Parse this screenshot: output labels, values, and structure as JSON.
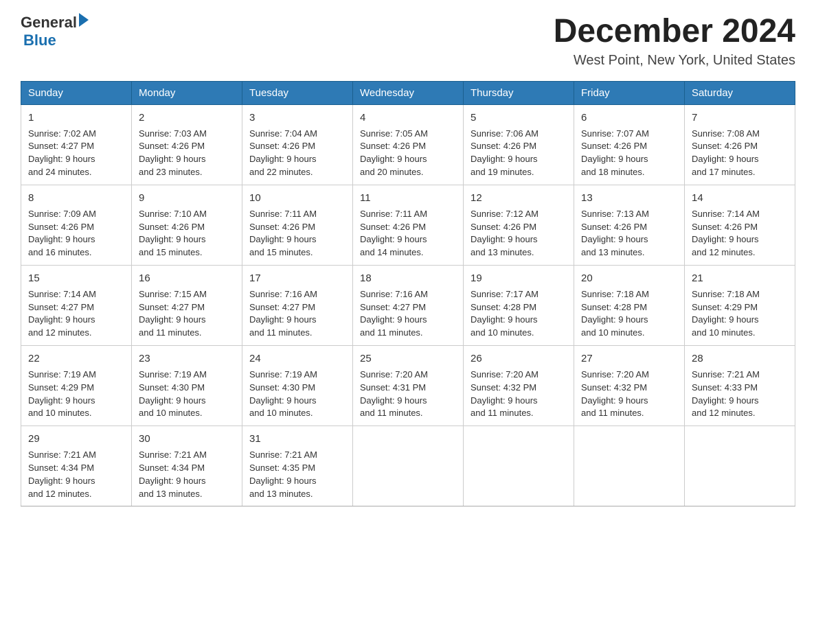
{
  "header": {
    "logo_general": "General",
    "logo_blue": "Blue",
    "month": "December 2024",
    "location": "West Point, New York, United States"
  },
  "days_of_week": [
    "Sunday",
    "Monday",
    "Tuesday",
    "Wednesday",
    "Thursday",
    "Friday",
    "Saturday"
  ],
  "weeks": [
    [
      {
        "day": 1,
        "lines": [
          "Sunrise: 7:02 AM",
          "Sunset: 4:27 PM",
          "Daylight: 9 hours",
          "and 24 minutes."
        ]
      },
      {
        "day": 2,
        "lines": [
          "Sunrise: 7:03 AM",
          "Sunset: 4:26 PM",
          "Daylight: 9 hours",
          "and 23 minutes."
        ]
      },
      {
        "day": 3,
        "lines": [
          "Sunrise: 7:04 AM",
          "Sunset: 4:26 PM",
          "Daylight: 9 hours",
          "and 22 minutes."
        ]
      },
      {
        "day": 4,
        "lines": [
          "Sunrise: 7:05 AM",
          "Sunset: 4:26 PM",
          "Daylight: 9 hours",
          "and 20 minutes."
        ]
      },
      {
        "day": 5,
        "lines": [
          "Sunrise: 7:06 AM",
          "Sunset: 4:26 PM",
          "Daylight: 9 hours",
          "and 19 minutes."
        ]
      },
      {
        "day": 6,
        "lines": [
          "Sunrise: 7:07 AM",
          "Sunset: 4:26 PM",
          "Daylight: 9 hours",
          "and 18 minutes."
        ]
      },
      {
        "day": 7,
        "lines": [
          "Sunrise: 7:08 AM",
          "Sunset: 4:26 PM",
          "Daylight: 9 hours",
          "and 17 minutes."
        ]
      }
    ],
    [
      {
        "day": 8,
        "lines": [
          "Sunrise: 7:09 AM",
          "Sunset: 4:26 PM",
          "Daylight: 9 hours",
          "and 16 minutes."
        ]
      },
      {
        "day": 9,
        "lines": [
          "Sunrise: 7:10 AM",
          "Sunset: 4:26 PM",
          "Daylight: 9 hours",
          "and 15 minutes."
        ]
      },
      {
        "day": 10,
        "lines": [
          "Sunrise: 7:11 AM",
          "Sunset: 4:26 PM",
          "Daylight: 9 hours",
          "and 15 minutes."
        ]
      },
      {
        "day": 11,
        "lines": [
          "Sunrise: 7:11 AM",
          "Sunset: 4:26 PM",
          "Daylight: 9 hours",
          "and 14 minutes."
        ]
      },
      {
        "day": 12,
        "lines": [
          "Sunrise: 7:12 AM",
          "Sunset: 4:26 PM",
          "Daylight: 9 hours",
          "and 13 minutes."
        ]
      },
      {
        "day": 13,
        "lines": [
          "Sunrise: 7:13 AM",
          "Sunset: 4:26 PM",
          "Daylight: 9 hours",
          "and 13 minutes."
        ]
      },
      {
        "day": 14,
        "lines": [
          "Sunrise: 7:14 AM",
          "Sunset: 4:26 PM",
          "Daylight: 9 hours",
          "and 12 minutes."
        ]
      }
    ],
    [
      {
        "day": 15,
        "lines": [
          "Sunrise: 7:14 AM",
          "Sunset: 4:27 PM",
          "Daylight: 9 hours",
          "and 12 minutes."
        ]
      },
      {
        "day": 16,
        "lines": [
          "Sunrise: 7:15 AM",
          "Sunset: 4:27 PM",
          "Daylight: 9 hours",
          "and 11 minutes."
        ]
      },
      {
        "day": 17,
        "lines": [
          "Sunrise: 7:16 AM",
          "Sunset: 4:27 PM",
          "Daylight: 9 hours",
          "and 11 minutes."
        ]
      },
      {
        "day": 18,
        "lines": [
          "Sunrise: 7:16 AM",
          "Sunset: 4:27 PM",
          "Daylight: 9 hours",
          "and 11 minutes."
        ]
      },
      {
        "day": 19,
        "lines": [
          "Sunrise: 7:17 AM",
          "Sunset: 4:28 PM",
          "Daylight: 9 hours",
          "and 10 minutes."
        ]
      },
      {
        "day": 20,
        "lines": [
          "Sunrise: 7:18 AM",
          "Sunset: 4:28 PM",
          "Daylight: 9 hours",
          "and 10 minutes."
        ]
      },
      {
        "day": 21,
        "lines": [
          "Sunrise: 7:18 AM",
          "Sunset: 4:29 PM",
          "Daylight: 9 hours",
          "and 10 minutes."
        ]
      }
    ],
    [
      {
        "day": 22,
        "lines": [
          "Sunrise: 7:19 AM",
          "Sunset: 4:29 PM",
          "Daylight: 9 hours",
          "and 10 minutes."
        ]
      },
      {
        "day": 23,
        "lines": [
          "Sunrise: 7:19 AM",
          "Sunset: 4:30 PM",
          "Daylight: 9 hours",
          "and 10 minutes."
        ]
      },
      {
        "day": 24,
        "lines": [
          "Sunrise: 7:19 AM",
          "Sunset: 4:30 PM",
          "Daylight: 9 hours",
          "and 10 minutes."
        ]
      },
      {
        "day": 25,
        "lines": [
          "Sunrise: 7:20 AM",
          "Sunset: 4:31 PM",
          "Daylight: 9 hours",
          "and 11 minutes."
        ]
      },
      {
        "day": 26,
        "lines": [
          "Sunrise: 7:20 AM",
          "Sunset: 4:32 PM",
          "Daylight: 9 hours",
          "and 11 minutes."
        ]
      },
      {
        "day": 27,
        "lines": [
          "Sunrise: 7:20 AM",
          "Sunset: 4:32 PM",
          "Daylight: 9 hours",
          "and 11 minutes."
        ]
      },
      {
        "day": 28,
        "lines": [
          "Sunrise: 7:21 AM",
          "Sunset: 4:33 PM",
          "Daylight: 9 hours",
          "and 12 minutes."
        ]
      }
    ],
    [
      {
        "day": 29,
        "lines": [
          "Sunrise: 7:21 AM",
          "Sunset: 4:34 PM",
          "Daylight: 9 hours",
          "and 12 minutes."
        ]
      },
      {
        "day": 30,
        "lines": [
          "Sunrise: 7:21 AM",
          "Sunset: 4:34 PM",
          "Daylight: 9 hours",
          "and 13 minutes."
        ]
      },
      {
        "day": 31,
        "lines": [
          "Sunrise: 7:21 AM",
          "Sunset: 4:35 PM",
          "Daylight: 9 hours",
          "and 13 minutes."
        ]
      },
      null,
      null,
      null,
      null
    ]
  ]
}
